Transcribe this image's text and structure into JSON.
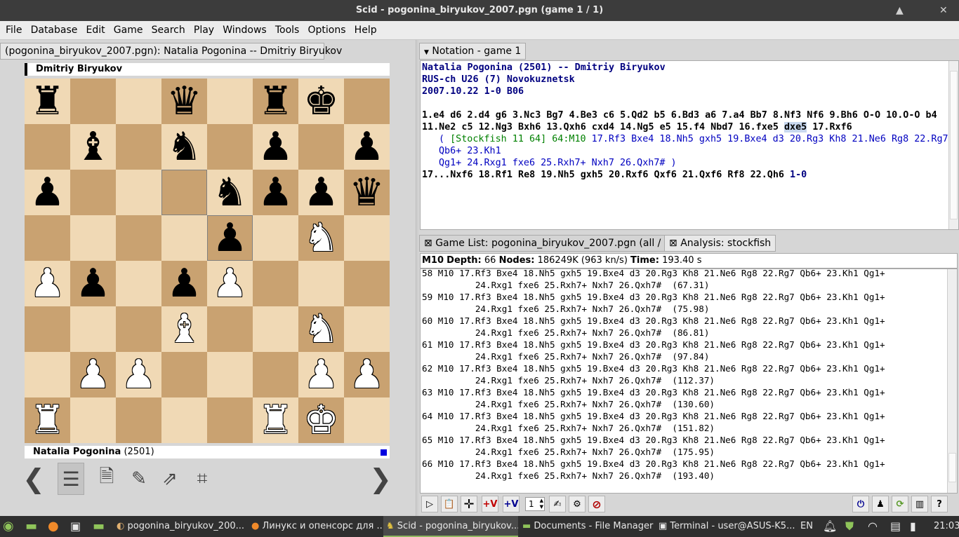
{
  "window": {
    "title": "Scid - pogonina_biryukov_2007.pgn (game 1 / 1)",
    "minimize": "▲",
    "close": "✕"
  },
  "menu": [
    "File",
    "Database",
    "Edit",
    "Game",
    "Search",
    "Play",
    "Windows",
    "Tools",
    "Options",
    "Help"
  ],
  "board_tab": "(pogonina_biryukov_2007.pgn): Natalia Pogonina -- Dmitriy Biryukov",
  "top_player": {
    "name": "Dmitriy Biryukov"
  },
  "bottom_player": {
    "name": "Natalia Pogonina",
    "rating": "(2501)"
  },
  "board_rows": [
    "rzzqzrkz",
    "zbznzpzp",
    "pzzznppq",
    "zzzzpzNz",
    "PpzpPzzz",
    "zzzBzzNz",
    "zPPzzzPP",
    "RzzzzRKz"
  ],
  "piece_symbols": {
    "K": "♚",
    "Q": "♛",
    "R": "♜",
    "B": "♝",
    "N": "♞",
    "P": "♟",
    "k": "♚",
    "q": "♛",
    "r": "♜",
    "b": "♝",
    "n": "♞",
    "p": "♟"
  },
  "notation": {
    "tab": "Notation - game 1",
    "header1": "Natalia Pogonina  (2501)  --  Dmitriy Biryukov",
    "header2": "RUS-ch U26 (7)  Novokuznetsk",
    "header3": "2007.10.22  1-0  B06",
    "moves1": "1.e4 d6 2.d4 g6 3.Nc3 Bg7 4.Be3 c6 5.Qd2 b5 6.Bd3 a6 7.a4 Bb7 8.Nf3 Nf6 9.Bh6 O-O 10.O-O b4",
    "moves2a": "11.Ne2 c5 12.Ng3 Bxh6 13.Qxh6 cxd4 14.Ng5 e5 15.f4 Nbd7 16.fxe5 ",
    "current_move": "dxe5",
    "moves2b": " 17.Rxf6",
    "var_open": "( ",
    "var_engine": "[Stockfish 11 64] 64:M10",
    "var_line1": " 17.Rf3 Bxe4 18.Nh5 gxh5 19.Bxe4 d3 20.Rg3 Kh8 21.Ne6 Rg8 22.Rg7 Qb6+ 23.Kh1",
    "var_line2": "Qg1+ 24.Rxg1 fxe6 25.Rxh7+ Nxh7 26.Qxh7# )",
    "moves3": "17...Nxf6 18.Rf1 Re8 19.Nh5 gxh5 20.Rxf6 Qxf6 21.Qxf6 Rf8 22.Qh6 ",
    "result": "1-0"
  },
  "tabs": {
    "gamelist": "Game List: pogonina_biryukov_2007.pgn (all / 1)",
    "analysis": "Analysis: stockfish"
  },
  "analysis_info": {
    "m": "M10",
    "depth_label": "Depth:",
    "depth": "66",
    "nodes_label": "Nodes:",
    "nodes": "186249K (963 kn/s)",
    "time_label": "Time:",
    "time": "193.40 s"
  },
  "analysis_lines": [
    "58 M10 17.Rf3 Bxe4 18.Nh5 gxh5 19.Bxe4 d3 20.Rg3 Kh8 21.Ne6 Rg8 22.Rg7 Qb6+ 23.Kh1 Qg1+",
    "          24.Rxg1 fxe6 25.Rxh7+ Nxh7 26.Qxh7#  (67.31)",
    "59 M10 17.Rf3 Bxe4 18.Nh5 gxh5 19.Bxe4 d3 20.Rg3 Kh8 21.Ne6 Rg8 22.Rg7 Qb6+ 23.Kh1 Qg1+",
    "          24.Rxg1 fxe6 25.Rxh7+ Nxh7 26.Qxh7#  (75.98)",
    "60 M10 17.Rf3 Bxe4 18.Nh5 gxh5 19.Bxe4 d3 20.Rg3 Kh8 21.Ne6 Rg8 22.Rg7 Qb6+ 23.Kh1 Qg1+",
    "          24.Rxg1 fxe6 25.Rxh7+ Nxh7 26.Qxh7#  (86.81)",
    "61 M10 17.Rf3 Bxe4 18.Nh5 gxh5 19.Bxe4 d3 20.Rg3 Kh8 21.Ne6 Rg8 22.Rg7 Qb6+ 23.Kh1 Qg1+",
    "          24.Rxg1 fxe6 25.Rxh7+ Nxh7 26.Qxh7#  (97.84)",
    "62 M10 17.Rf3 Bxe4 18.Nh5 gxh5 19.Bxe4 d3 20.Rg3 Kh8 21.Ne6 Rg8 22.Rg7 Qb6+ 23.Kh1 Qg1+",
    "          24.Rxg1 fxe6 25.Rxh7+ Nxh7 26.Qxh7#  (112.37)",
    "63 M10 17.Rf3 Bxe4 18.Nh5 gxh5 19.Bxe4 d3 20.Rg3 Kh8 21.Ne6 Rg8 22.Rg7 Qb6+ 23.Kh1 Qg1+",
    "          24.Rxg1 fxe6 25.Rxh7+ Nxh7 26.Qxh7#  (130.60)",
    "64 M10 17.Rf3 Bxe4 18.Nh5 gxh5 19.Bxe4 d3 20.Rg3 Kh8 21.Ne6 Rg8 22.Rg7 Qb6+ 23.Kh1 Qg1+",
    "          24.Rxg1 fxe6 25.Rxh7+ Nxh7 26.Qxh7#  (151.82)",
    "65 M10 17.Rf3 Bxe4 18.Nh5 gxh5 19.Bxe4 d3 20.Rg3 Kh8 21.Ne6 Rg8 22.Rg7 Qb6+ 23.Kh1 Qg1+",
    "          24.Rxg1 fxe6 25.Rxh7+ Nxh7 26.Qxh7#  (175.95)",
    "66 M10 17.Rf3 Bxe4 18.Nh5 gxh5 19.Bxe4 d3 20.Rg3 Kh8 21.Ne6 Rg8 22.Rg7 Qb6+ 23.Kh1 Qg1+",
    "          24.Rxg1 fxe6 25.Rxh7+ Nxh7 26.Qxh7#  (193.40)"
  ],
  "analysis_toolbar": {
    "plus_v": "+V",
    "spin_value": "1"
  },
  "taskbar": {
    "items": [
      "pogonina_biryukov_200...",
      "Линукс и опенсорс для ...",
      "Scid - pogonina_biryukov...",
      "Documents - File Manager",
      "Terminal - user@ASUS-K5..."
    ],
    "lang": "EN",
    "clock": "21:03"
  }
}
